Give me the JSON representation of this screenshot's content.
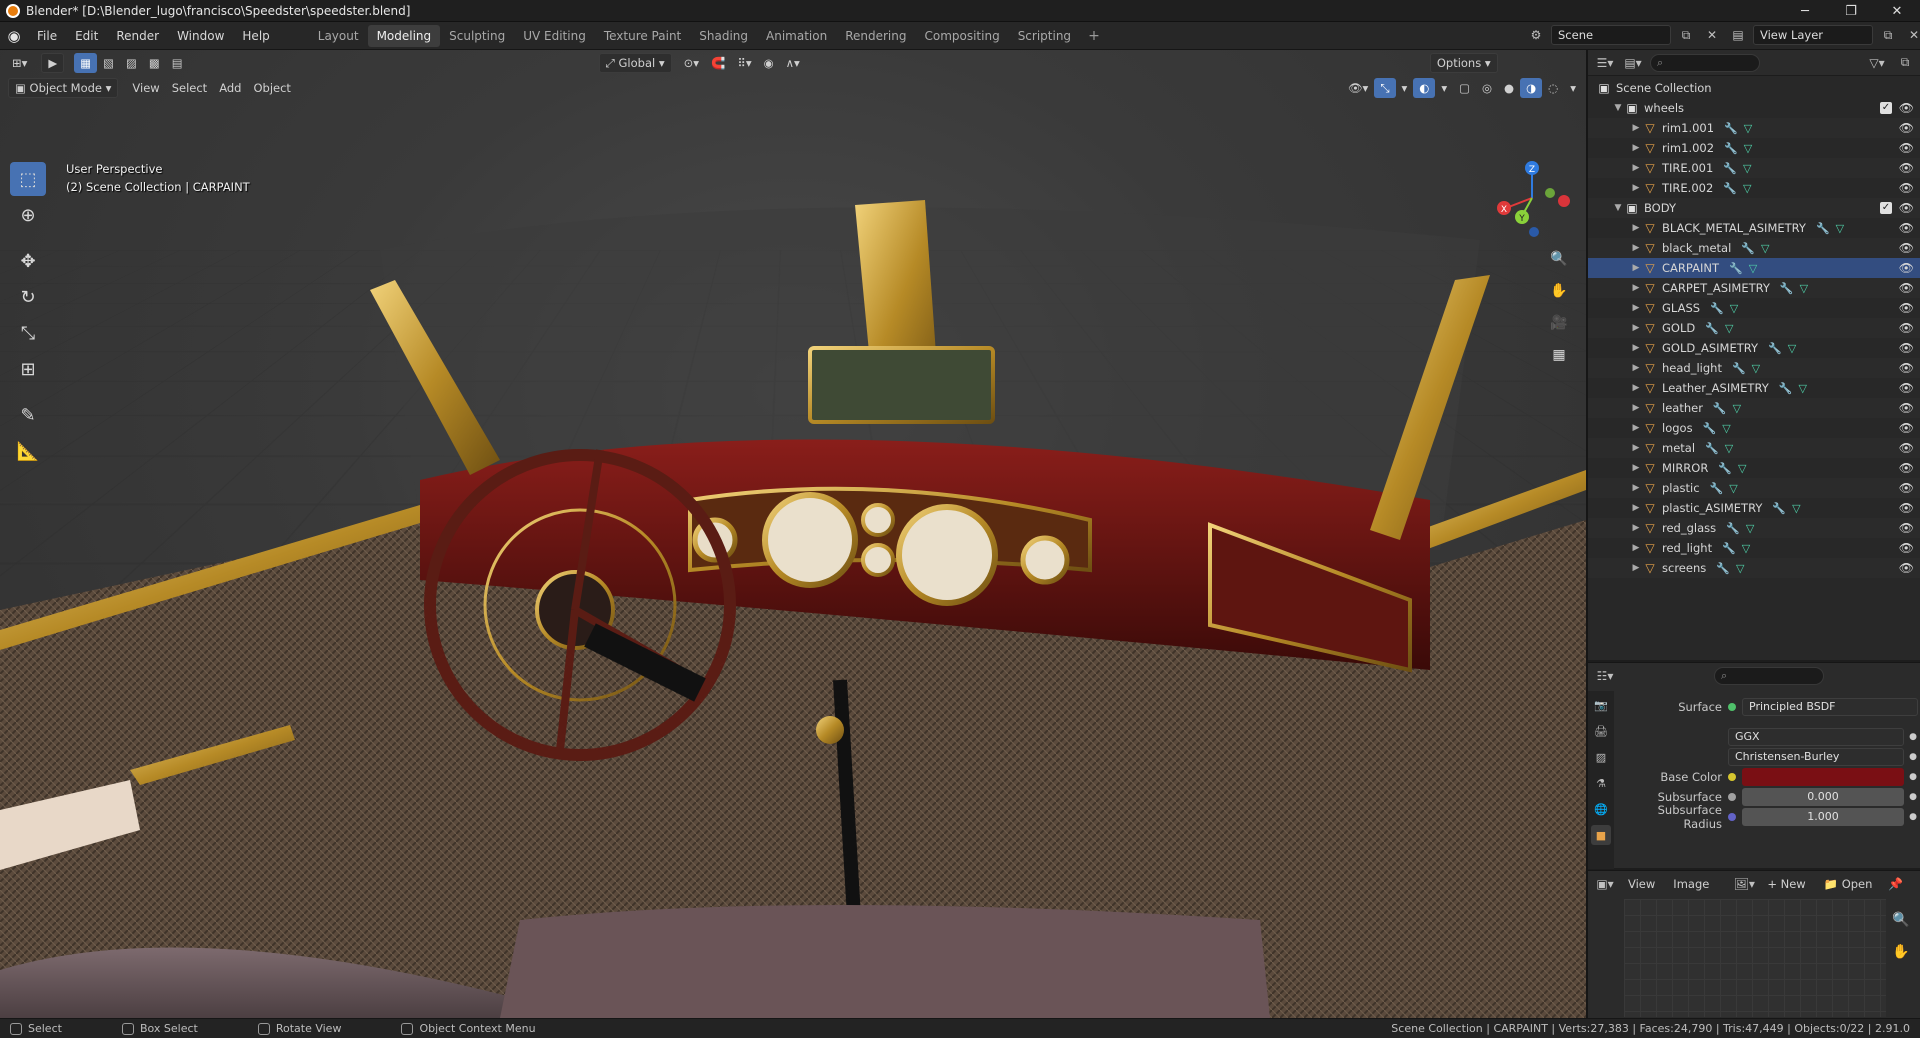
{
  "window": {
    "title": "Blender* [D:\\Blender_lugo\\francisco\\Speedster\\speedster.blend]"
  },
  "menu": {
    "items": [
      "File",
      "Edit",
      "Render",
      "Window",
      "Help"
    ]
  },
  "workspaces": {
    "tabs": [
      "Layout",
      "Modeling",
      "Sculpting",
      "UV Editing",
      "Texture Paint",
      "Shading",
      "Animation",
      "Rendering",
      "Compositing",
      "Scripting"
    ],
    "active": "Modeling"
  },
  "scene": {
    "name": "Scene",
    "view_layer": "View Layer"
  },
  "viewport": {
    "transform_orientation": "Global",
    "options_label": "Options",
    "mode": "Object Mode",
    "header_menus": [
      "View",
      "Select",
      "Add",
      "Object"
    ],
    "info_line1": "User Perspective",
    "info_line2": "(2) Scene Collection | CARPAINT"
  },
  "outliner": {
    "root": "Scene Collection",
    "rows": [
      {
        "label": "wheels",
        "type": "collection",
        "depth": 1
      },
      {
        "label": "rim1.001",
        "type": "mesh",
        "depth": 2
      },
      {
        "label": "rim1.002",
        "type": "mesh",
        "depth": 2
      },
      {
        "label": "TIRE.001",
        "type": "mesh",
        "depth": 2
      },
      {
        "label": "TIRE.002",
        "type": "mesh",
        "depth": 2
      },
      {
        "label": "BODY",
        "type": "collection",
        "depth": 1
      },
      {
        "label": "BLACK_METAL_ASIMETRY",
        "type": "mesh",
        "depth": 2
      },
      {
        "label": "black_metal",
        "type": "mesh",
        "depth": 2
      },
      {
        "label": "CARPAINT",
        "type": "mesh",
        "depth": 2,
        "selected": true
      },
      {
        "label": "CARPET_ASIMETRY",
        "type": "mesh",
        "depth": 2
      },
      {
        "label": "GLASS",
        "type": "mesh",
        "depth": 2
      },
      {
        "label": "GOLD",
        "type": "mesh",
        "depth": 2
      },
      {
        "label": "GOLD_ASIMETRY",
        "type": "mesh",
        "depth": 2
      },
      {
        "label": "head_light",
        "type": "mesh",
        "depth": 2
      },
      {
        "label": "Leather_ASIMETRY",
        "type": "mesh",
        "depth": 2
      },
      {
        "label": "leather",
        "type": "mesh",
        "depth": 2
      },
      {
        "label": "logos",
        "type": "mesh",
        "depth": 2
      },
      {
        "label": "metal",
        "type": "mesh",
        "depth": 2
      },
      {
        "label": "MIRROR",
        "type": "mesh",
        "depth": 2
      },
      {
        "label": "plastic",
        "type": "mesh",
        "depth": 2
      },
      {
        "label": "plastic_ASIMETRY",
        "type": "mesh",
        "depth": 2
      },
      {
        "label": "red_glass",
        "type": "mesh",
        "depth": 2
      },
      {
        "label": "red_light",
        "type": "mesh",
        "depth": 2
      },
      {
        "label": "screens",
        "type": "mesh",
        "depth": 2
      }
    ]
  },
  "properties": {
    "surface_label": "Surface",
    "surface_value": "Principled BSDF",
    "distribution": "GGX",
    "subsurface_method": "Christensen-Burley",
    "base_color_label": "Base Color",
    "base_color": "#7a0f14",
    "subsurface_label": "Subsurface",
    "subsurface_value": "0.000",
    "subsurface_radius_label": "Subsurface Radius",
    "subsurface_radius_value": "1.000"
  },
  "image_editor": {
    "menus": [
      "View",
      "Image"
    ],
    "new_label": "New",
    "open_label": "Open"
  },
  "statusbar": {
    "select": "Select",
    "box_select": "Box Select",
    "rotate_view": "Rotate View",
    "context_menu": "Object Context Menu",
    "stats": "Scene Collection | CARPAINT | Verts:27,383 | Faces:24,790 | Tris:47,449 | Objects:0/22 | 2.91.0"
  },
  "colors": {
    "accent": "#4772b3",
    "car_body": "#6a1412",
    "gold": "#c9a23a"
  }
}
